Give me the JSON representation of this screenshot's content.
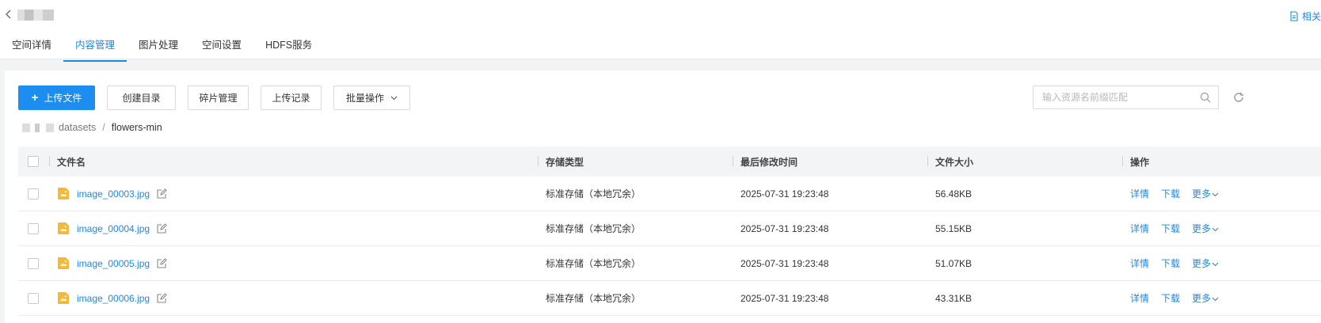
{
  "header": {
    "related_label": "相关",
    "tabs": [
      {
        "label": "空间详情"
      },
      {
        "label": "内容管理"
      },
      {
        "label": "图片处理"
      },
      {
        "label": "空间设置"
      },
      {
        "label": "HDFS服务"
      }
    ],
    "active_tab_index": 1
  },
  "toolbar": {
    "upload_label": "上传文件",
    "create_dir_label": "创建目录",
    "fragment_label": "碎片管理",
    "upload_log_label": "上传记录",
    "batch_label": "批量操作"
  },
  "search": {
    "placeholder": "输入资源名前缀匹配",
    "value": ""
  },
  "breadcrumb": {
    "folder": "datasets",
    "separator": "/",
    "current": "flowers-min"
  },
  "table": {
    "headers": {
      "name": "文件名",
      "type": "存储类型",
      "time": "最后修改时间",
      "size": "文件大小",
      "ops": "操作"
    },
    "rows": [
      {
        "name": "image_00003.jpg",
        "type": "标准存储（本地冗余）",
        "time": "2025-07-31 19:23:48",
        "size": "56.48KB"
      },
      {
        "name": "image_00004.jpg",
        "type": "标准存储（本地冗余）",
        "time": "2025-07-31 19:23:48",
        "size": "55.15KB"
      },
      {
        "name": "image_00005.jpg",
        "type": "标准存储（本地冗余）",
        "time": "2025-07-31 19:23:48",
        "size": "51.07KB"
      },
      {
        "name": "image_00006.jpg",
        "type": "标准存储（本地冗余）",
        "time": "2025-07-31 19:23:48",
        "size": "43.31KB"
      }
    ],
    "ops": {
      "detail": "详情",
      "download": "下载",
      "more": "更多"
    }
  },
  "colors": {
    "accent": "#1e88e5",
    "primary_button": "#1b8ef0",
    "file_icon": "#f5b93a"
  },
  "icons": {
    "back": "chevron-left-icon",
    "related": "document-icon",
    "search": "search-icon",
    "refresh": "refresh-icon",
    "file": "image-file-icon",
    "edit": "edit-icon"
  }
}
